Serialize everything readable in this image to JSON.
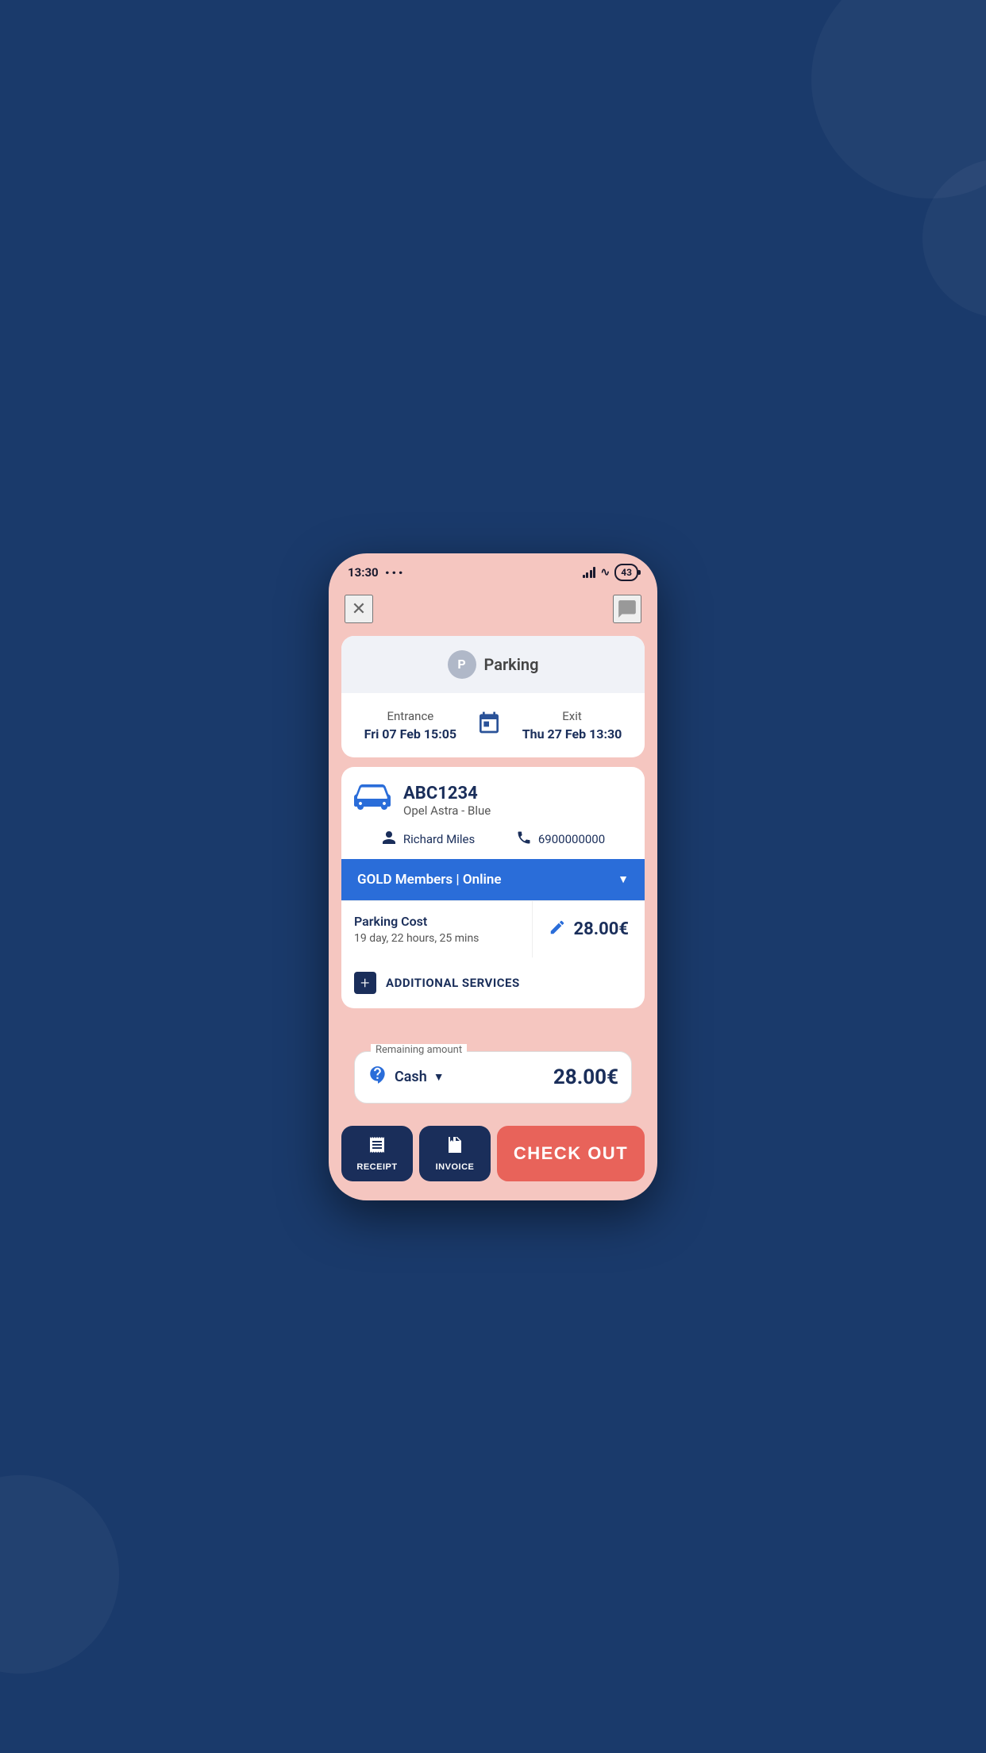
{
  "status_bar": {
    "time": "13:30",
    "dots": "···",
    "battery": "43"
  },
  "nav": {
    "close_icon": "✕",
    "chat_icon": "💬"
  },
  "parking": {
    "icon_letter": "P",
    "label": "Parking"
  },
  "dates": {
    "entrance_label": "Entrance",
    "entrance_value": "Fri 07 Feb 15:05",
    "exit_label": "Exit",
    "exit_value": "Thu 27 Feb 13:30"
  },
  "vehicle": {
    "plate": "ABC1234",
    "model": "Opel Astra - Blue"
  },
  "contact": {
    "name": "Richard Miles",
    "phone": "6900000000"
  },
  "membership": {
    "label": "GOLD Members | Online"
  },
  "pricing": {
    "cost_label": "Parking Cost",
    "duration": "19 day, 22 hours, 25 mins",
    "price": "28.00€"
  },
  "additional": {
    "label": "ADDITIONAL SERVICES"
  },
  "remaining": {
    "label": "Remaining amount",
    "payment_method": "Cash",
    "amount": "28.00€"
  },
  "actions": {
    "receipt_label": "RECEIPT",
    "invoice_label": "INVOICE",
    "checkout_label": "CHECK OUT"
  }
}
